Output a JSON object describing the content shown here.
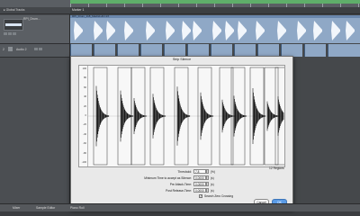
{
  "arrange": {
    "global_tracks_label": "Global Tracks",
    "marker_label": "Marker 1",
    "region_name": "RPI_Drum_118_Madrid+RJ.1X",
    "track_1": {
      "name": "RPI_Drum..."
    },
    "track_2": {
      "number": "2",
      "name": "Audio 2"
    }
  },
  "strip_silence": {
    "title": "Strip Silence",
    "y_labels": [
      "100",
      "80",
      "60",
      "40",
      "20",
      "0",
      "-20",
      "-40",
      "-60",
      "-80",
      "-100"
    ],
    "regions_count": "12 Regions",
    "threshold": {
      "label": "Threshold:",
      "value": "7.8",
      "unit": "(%)"
    },
    "min_time": {
      "label": "Minimum Time to accept as Silence:",
      "value": "0.0000",
      "unit": "(s)"
    },
    "pre_attack": {
      "label": "Pre Attack-Time:",
      "value": "0.0000",
      "unit": "(s)"
    },
    "post_release": {
      "label": "Post Release-Time:",
      "value": "0.0000",
      "unit": "(s)"
    },
    "search_zero_crossing": {
      "label": "Search Zero Crossing",
      "checked": true
    },
    "cancel_label": "Cancel",
    "ok_label": "OK",
    "waveform_color": "#1a1a1a"
  },
  "bottom_bar": {
    "tabs": [
      "Mixer",
      "Sample Editor",
      "Piano Roll"
    ]
  },
  "colors": {
    "region_blue": "#8fa8c6",
    "cycle_green": "#5fae6a",
    "ok_blue": "#5a9be6"
  }
}
